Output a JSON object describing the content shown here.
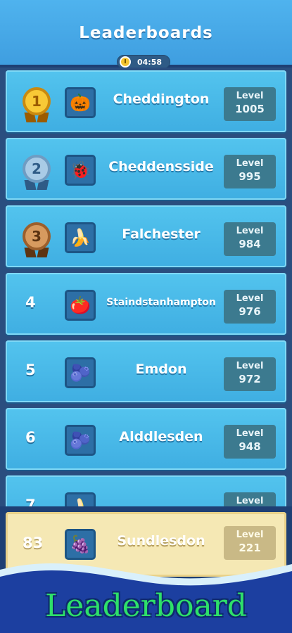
{
  "header": {
    "title": "Leaderboards",
    "timer": "04:58"
  },
  "level_label": "Level",
  "rows": [
    {
      "rank": "1",
      "medal": "gold",
      "icon": "pumpkin-icon",
      "emoji": "🎃",
      "name": "Cheddington",
      "level": "1005"
    },
    {
      "rank": "2",
      "medal": "silver",
      "icon": "ladybug-icon",
      "emoji": "🐞",
      "name": "Cheddensside",
      "level": "995"
    },
    {
      "rank": "3",
      "medal": "bronze",
      "icon": "banana-icon",
      "emoji": "🍌",
      "name": "Falchester",
      "level": "984"
    },
    {
      "rank": "4",
      "medal": "",
      "icon": "tomato-icon",
      "emoji": "🍅",
      "name": "Staindstanhampton",
      "level": "976"
    },
    {
      "rank": "5",
      "medal": "",
      "icon": "blueberry-icon",
      "emoji": "🫐",
      "name": "Emdon",
      "level": "972"
    },
    {
      "rank": "6",
      "medal": "",
      "icon": "blueberry-icon",
      "emoji": "🫐",
      "name": "Alddlesden",
      "level": "948"
    },
    {
      "rank": "7",
      "medal": "",
      "icon": "banana-icon",
      "emoji": "🍌",
      "name": "",
      "level": ""
    }
  ],
  "self": {
    "rank": "83",
    "icon": "grapes-icon",
    "emoji": "🍇",
    "name": "Sundlesdon",
    "level": "221"
  },
  "footer": {
    "caption": "Leaderboard"
  },
  "colors": {
    "gold": "#f2b320",
    "silver": "#8fb6d6",
    "bronze": "#b87a45",
    "row": "#49b8e8",
    "self_row": "#f5e8b4",
    "footer_text": "#2ee06a"
  }
}
